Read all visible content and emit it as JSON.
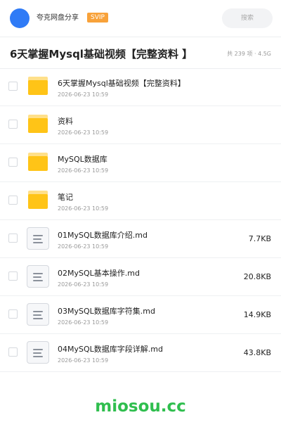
{
  "header": {
    "user_name": "夸克网盘分享",
    "vip_label": "SVIP",
    "search_label": "搜索"
  },
  "title_bar": {
    "title": "6天掌握Mysql基础视频【完整资料 】",
    "summary": "共 239 项 · 4.5G"
  },
  "files": [
    {
      "type": "folder",
      "name": "6天掌握Mysql基础视频【完整资料】",
      "date": "2026-06-23 10:59",
      "size": ""
    },
    {
      "type": "folder",
      "name": "资料",
      "date": "2026-06-23 10:59",
      "size": ""
    },
    {
      "type": "folder",
      "name": "MySQL数据库",
      "date": "2026-06-23 10:59",
      "size": ""
    },
    {
      "type": "folder",
      "name": "笔记",
      "date": "2026-06-23 10:59",
      "size": ""
    },
    {
      "type": "document",
      "name": "01MySQL数据库介绍.md",
      "date": "2026-06-23 10:59",
      "size": "7.7KB"
    },
    {
      "type": "document",
      "name": "02MySQL基本操作.md",
      "date": "2026-06-23 10:59",
      "size": "20.8KB"
    },
    {
      "type": "document",
      "name": "03MySQL数据库字符集.md",
      "date": "2026-06-23 10:59",
      "size": "14.9KB"
    },
    {
      "type": "document",
      "name": "04MySQL数据库字段详解.md",
      "date": "2026-06-23 10:59",
      "size": "43.8KB"
    }
  ],
  "watermark": "miosou.cc",
  "colors": {
    "avatar": "#2f7bf6",
    "vip_badge": "#f8a23a",
    "folder": "#ffc417",
    "watermark": "#2fbe4e"
  },
  "icons": {
    "folder": "folder-icon",
    "document": "document-icon"
  }
}
